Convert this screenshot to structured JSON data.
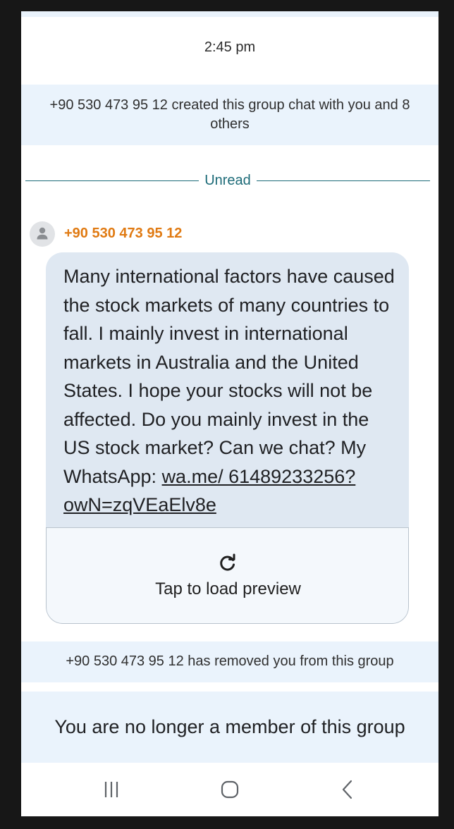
{
  "chat": {
    "timestamp": "2:45 pm",
    "created_notice": "+90 530 473 95 12 created this group chat with you and 8 others",
    "unread_label": "Unread",
    "message": {
      "sender": "+90 530 473 95 12",
      "text": "Many international factors have caused the stock markets of many countries to fall. I mainly invest in international markets in Australia and the United States. I hope your stocks will not be affected. Do you mainly invest in the US stock market? Can we chat? My WhatsApp: ",
      "link_text": "wa.me/ 61489233256?owN=zqVEaElv8e",
      "preview_label": "Tap to load preview"
    },
    "removed_notice": "+90 530 473 95 12 has removed you from this group",
    "no_longer_member": "You are no longer a member of this group"
  },
  "icons": {
    "avatar": "person-icon",
    "reload": "refresh-icon",
    "nav_recents": "recents-icon",
    "nav_home": "home-icon",
    "nav_back": "back-icon"
  },
  "colors": {
    "sender_name": "#e07a12",
    "unread_divider": "#1d6b78",
    "system_box_bg": "#eaf3fc",
    "bubble_bg": "#dfe8f2"
  }
}
